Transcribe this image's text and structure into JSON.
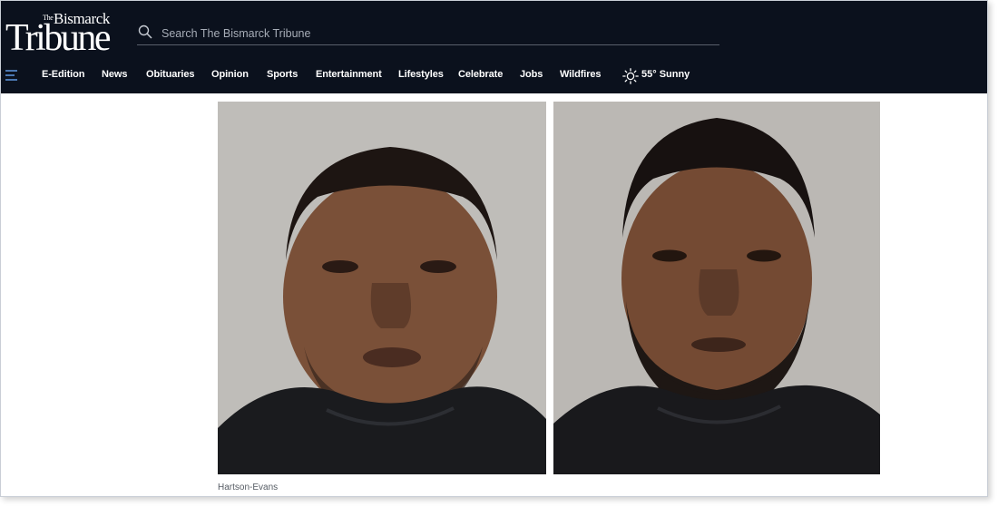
{
  "brand": {
    "logo_the": "The",
    "logo_city": "Bismarck",
    "logo_name": "Tribune",
    "header_bg": "#0b111d"
  },
  "search": {
    "placeholder": "Search The Bismarck Tribune",
    "icon": "search-icon"
  },
  "nav": {
    "menu_icon": "hamburger-menu-icon",
    "items": [
      {
        "label": "E-Edition"
      },
      {
        "label": "News"
      },
      {
        "label": "Obituaries"
      },
      {
        "label": "Opinion"
      },
      {
        "label": "Sports"
      },
      {
        "label": "Entertainment"
      },
      {
        "label": "Lifestyles"
      },
      {
        "label": "Celebrate"
      },
      {
        "label": "Jobs"
      },
      {
        "label": "Wildfires"
      }
    ],
    "weather": {
      "icon": "sun-icon",
      "label": "55° Sunny"
    }
  },
  "article": {
    "photos": [
      {
        "name": "mugshot-left",
        "icon": "person-photo"
      },
      {
        "name": "mugshot-right",
        "icon": "person-photo"
      }
    ],
    "caption": "Hartson-Evans"
  }
}
